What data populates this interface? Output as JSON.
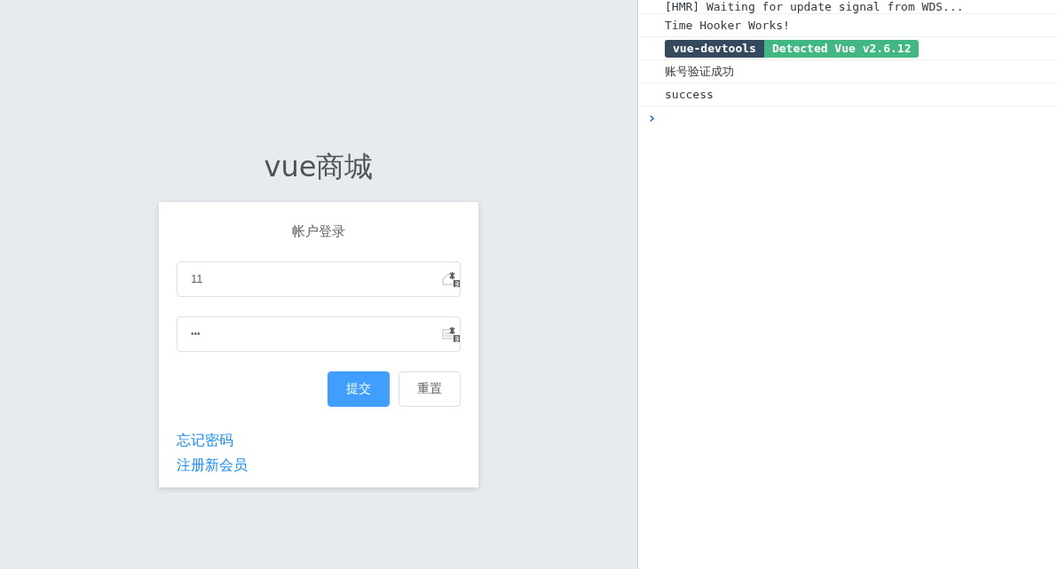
{
  "login": {
    "title": "vue商城",
    "card_title": "帐户登录",
    "username": {
      "value": "11"
    },
    "password": {
      "value": "•••"
    },
    "buttons": [
      {
        "label": "提交",
        "kind": "primary"
      },
      {
        "label": "重置",
        "kind": "default"
      }
    ],
    "links": [
      "忘记密码",
      "注册新会员"
    ]
  },
  "console": {
    "lines": [
      {
        "kind": "text",
        "text": "[HMR] Waiting for update signal from WDS..."
      },
      {
        "kind": "text",
        "text": "Time Hooker Works!"
      },
      {
        "kind": "badge",
        "left": "vue-devtools",
        "right": "Detected Vue v2.6.12"
      },
      {
        "kind": "text",
        "text": "账号验证成功"
      },
      {
        "kind": "text",
        "text": "success"
      }
    ],
    "prompt": "›"
  }
}
